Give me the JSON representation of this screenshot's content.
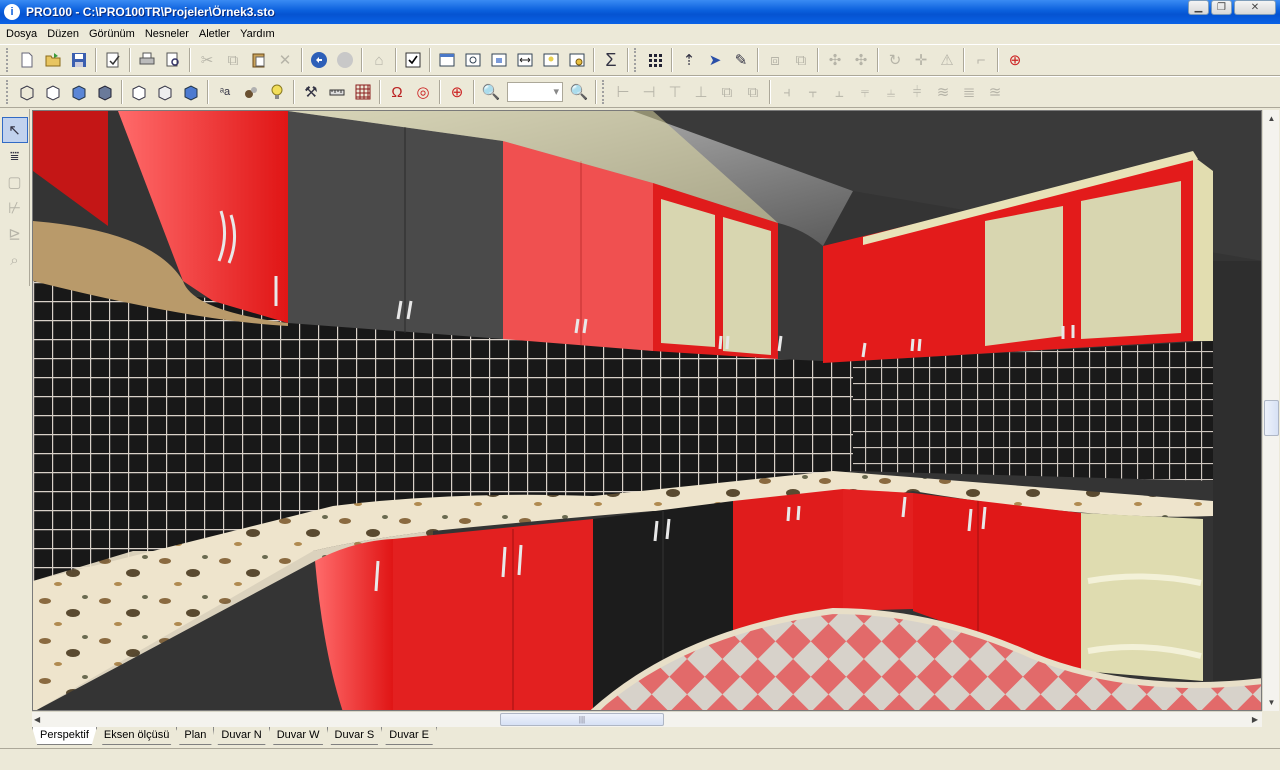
{
  "window": {
    "title": "PRO100 - C:\\PRO100TR\\Projeler\\Örnek3.sto",
    "app_icon": "info-icon"
  },
  "menu": [
    "Dosya",
    "Düzen",
    "Görünüm",
    "Nesneler",
    "Aletler",
    "Yardım"
  ],
  "toolbar1": [
    "new-file-icon",
    "open-folder-icon",
    "save-icon",
    "properties-icon",
    "print-icon",
    "print-preview-icon",
    "cut-icon",
    "copy-icon",
    "paste-icon",
    "delete-icon",
    "undo-icon",
    "redo-icon",
    "library-icon",
    "check-icon",
    "view-list-icon",
    "zoom-window-icon",
    "select-icon",
    "fit-width-icon",
    "notes-icon",
    "render-icon",
    "sum-icon",
    "grid-dots-icon",
    "move-up-icon",
    "pointer-icon",
    "pen-icon",
    "group-icon",
    "ungroup-icon",
    "rotate-icon",
    "flip-icon",
    "refresh-icon",
    "move-icon",
    "warning-icon",
    "door-icon",
    "target-icon"
  ],
  "toolbar2_zoom_value": "",
  "left_tools": [
    "arrow-select-icon",
    "wall-tool-icon",
    "box-tool-icon",
    "dimension-icon",
    "edit-icon",
    "zoom-icon"
  ],
  "tabs": [
    "Perspektif",
    "Eksen ölçüsü",
    "Plan",
    "Duvar N",
    "Duvar W",
    "Duvar S",
    "Duvar E"
  ],
  "active_tab": "Perspektif",
  "colors": {
    "cabinet_red": "#e01c1c",
    "cabinet_dark": "#3a3a3a",
    "glass": "#d8d6b0",
    "tile": "#1a1a1a",
    "countertop": "#efe7d2"
  }
}
